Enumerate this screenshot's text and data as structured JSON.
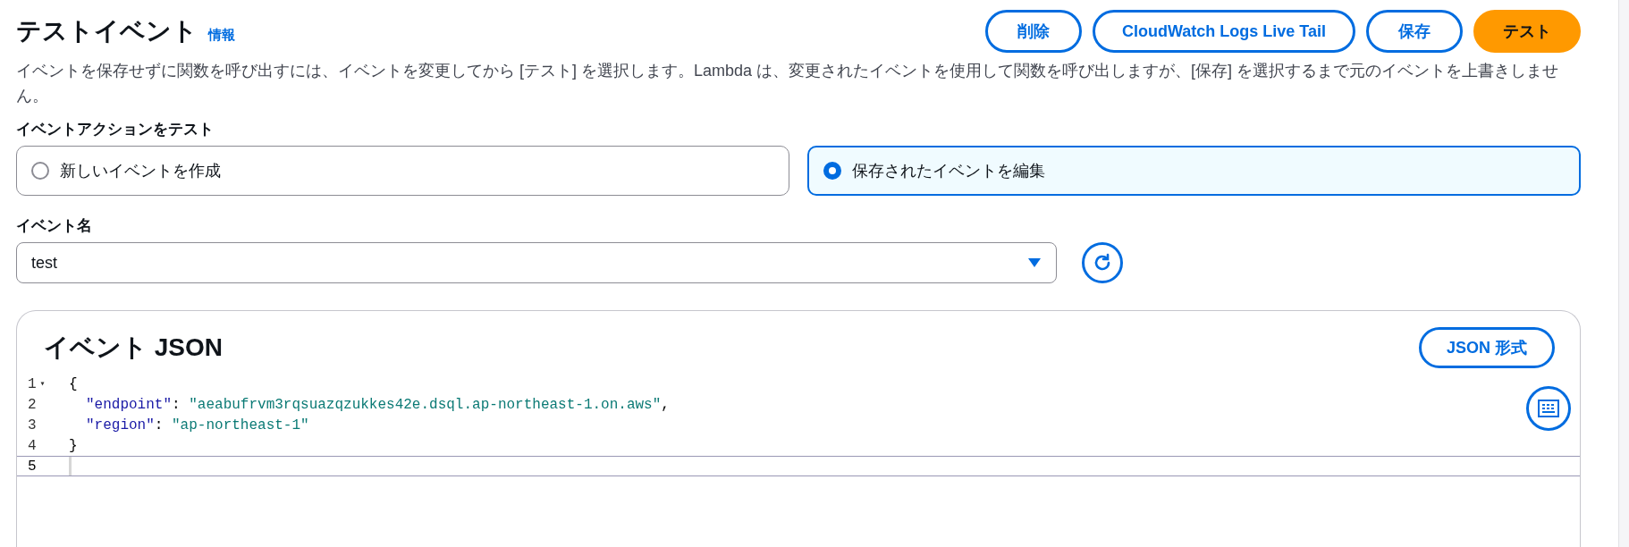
{
  "header": {
    "title": "テストイベント",
    "info_link": "情報",
    "buttons": [
      {
        "label": "削除",
        "kind": "normal"
      },
      {
        "label": "CloudWatch Logs Live Tail",
        "kind": "normal"
      },
      {
        "label": "保存",
        "kind": "normal"
      },
      {
        "label": "テスト",
        "kind": "primary"
      }
    ],
    "description": "イベントを保存せずに関数を呼び出すには、イベントを変更してから [テスト] を選択します。Lambda は、変更されたイベントを使用して関数を呼び出しますが、[保存] を選択するまで元のイベントを上書きしません。"
  },
  "event_action": {
    "label": "イベントアクションをテスト",
    "options": [
      {
        "label": "新しいイベントを作成",
        "selected": false
      },
      {
        "label": "保存されたイベントを編集",
        "selected": true
      }
    ]
  },
  "event_name": {
    "label": "イベント名",
    "value": "test"
  },
  "editor": {
    "title": "イベント JSON",
    "format_button": "JSON 形式",
    "lines": [
      {
        "number": "1",
        "fold_marker": "▾",
        "indent": false,
        "active": false,
        "tokens": [
          {
            "kind": "punct",
            "text": "{"
          }
        ]
      },
      {
        "number": "2",
        "indent": true,
        "active": false,
        "tokens": [
          {
            "kind": "key",
            "text": "\"endpoint\""
          },
          {
            "kind": "punct",
            "text": ": "
          },
          {
            "kind": "string",
            "text": "\"aeabufrvm3rqsuazqzukkes42e.dsql.ap-northeast-1.on.aws\""
          },
          {
            "kind": "punct",
            "text": ","
          }
        ]
      },
      {
        "number": "3",
        "indent": true,
        "active": false,
        "tokens": [
          {
            "kind": "key",
            "text": "\"region\""
          },
          {
            "kind": "punct",
            "text": ": "
          },
          {
            "kind": "string",
            "text": "\"ap-northeast-1\""
          }
        ]
      },
      {
        "number": "4",
        "indent": false,
        "active": false,
        "tokens": [
          {
            "kind": "punct",
            "text": "}"
          }
        ]
      },
      {
        "number": "5",
        "active": true
      }
    ]
  }
}
